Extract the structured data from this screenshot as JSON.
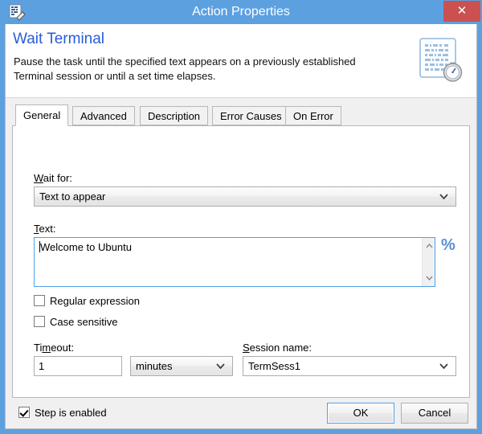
{
  "window": {
    "title": "Action Properties",
    "icon": "action-properties-icon",
    "close_label": "✕",
    "accent_blue": "#5ca0e0",
    "close_red": "#cb5050"
  },
  "header": {
    "title": "Wait Terminal",
    "title_color": "#2a5bd7",
    "description": "Pause the task until the specified text appears on a previously established Terminal session or until a set time elapses.",
    "icon": "wait-terminal-icon"
  },
  "tabs": [
    {
      "label": "General",
      "selected": true
    },
    {
      "label": "Advanced",
      "selected": false
    },
    {
      "label": "Description",
      "selected": false
    },
    {
      "label": "Error Causes",
      "selected": false
    },
    {
      "label": "On Error",
      "selected": false
    }
  ],
  "general": {
    "wait_for": {
      "label": "Wait for:",
      "accelerator": "W",
      "value": "Text to appear"
    },
    "text": {
      "label": "Text:",
      "accelerator": "T",
      "value": "Welcome to Ubuntu",
      "variable_button": "%"
    },
    "regular_expression": {
      "label": "Regular expression",
      "checked": false
    },
    "case_sensitive": {
      "label": "Case sensitive",
      "checked": false
    },
    "timeout": {
      "label": "Timeout:",
      "accelerator": "m",
      "value": "1",
      "units": "minutes"
    },
    "session_name": {
      "label": "Session name:",
      "accelerator": "S",
      "value": "TermSess1"
    }
  },
  "footer": {
    "step_is_enabled": {
      "label": "Step is enabled",
      "checked": true
    },
    "ok_label": "OK",
    "cancel_label": "Cancel"
  }
}
